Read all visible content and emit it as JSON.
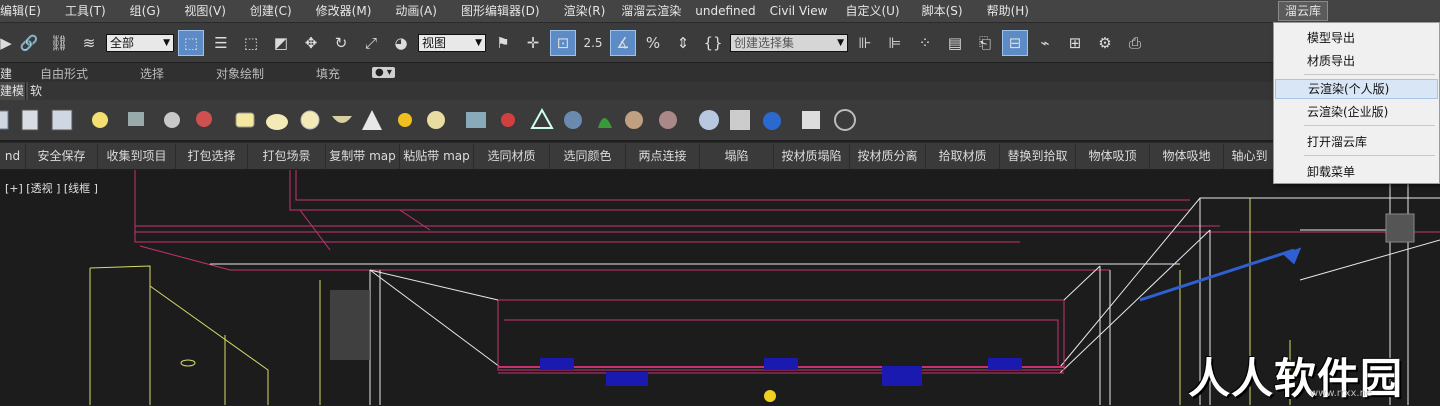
{
  "menubar": {
    "items": [
      "编辑(E)",
      "工具(T)",
      "组(G)",
      "视图(V)",
      "创建(C)",
      "修改器(M)",
      "动画(A)",
      "图形编辑器(D)",
      "渲染(R)",
      "溜溜云渲染",
      "undefined",
      "Civil View",
      "自定义(U)",
      "脚本(S)",
      "帮助(H)"
    ],
    "active_menu": "溜云库"
  },
  "toolbar1": {
    "selection_filter": "全部",
    "reference_coord": "视图",
    "snap_value": "2.5",
    "named_selection_placeholder": "创建选择集"
  },
  "ribbon": {
    "tabs": [
      "建",
      "自由形式",
      "选择",
      "对象绘制",
      "填充"
    ]
  },
  "subtabs": {
    "items": [
      "建模",
      "软"
    ]
  },
  "command_bar": {
    "items": [
      "nd",
      "安全保存",
      "收集到项目",
      "打包选择",
      "打包场景",
      "复制带 map",
      "粘贴带 map",
      "选同材质",
      "选同颜色",
      "两点连接",
      "塌陷",
      "按材质塌陷",
      "按材质分离",
      "拾取材质",
      "替换到拾取",
      "物体吸顶",
      "物体吸地",
      "轴心到"
    ]
  },
  "viewport": {
    "label": "[+] [透视 ] [线框 ]"
  },
  "dropdown": {
    "items": [
      "模型导出",
      "材质导出",
      "云渲染(个人版)",
      "云渲染(企业版)",
      "打开溜云库",
      "卸载菜单"
    ],
    "highlighted_index": 2
  },
  "watermark": {
    "text": "人人软件园",
    "url": "www.rrxx.ne"
  },
  "colors": {
    "menubar_bg": "#444444",
    "toolbar_bg": "#3b3b3b",
    "highlight_blue": "#5d8bc6",
    "wire_magenta": "#c6326e",
    "wire_yellow": "#d8d86a",
    "wire_white": "#e8e8e8",
    "annotation_arrow": "#2f5fd0"
  }
}
